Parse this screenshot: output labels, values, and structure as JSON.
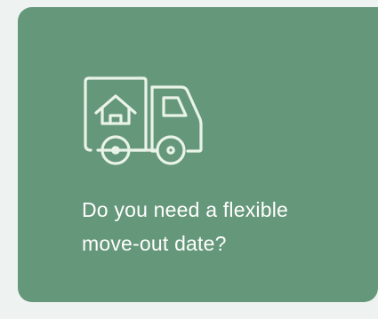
{
  "card": {
    "icon": "moving-truck-with-house-icon",
    "text_line_1": "Do you need a flexible",
    "text_line_2": "move-out date?"
  },
  "colors": {
    "card_background": "#65977a",
    "page_background": "#eef3f1",
    "icon_stroke": "#e9f3e8",
    "text": "#ffffff"
  }
}
